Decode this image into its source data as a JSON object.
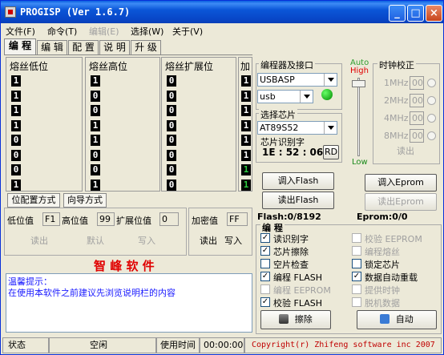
{
  "window": {
    "title": "PROGISP  (Ver 1.6.7)"
  },
  "title_buttons": {
    "minimize": "_",
    "maximize": "□",
    "close": "×"
  },
  "menu": [
    "文件(F)",
    "命令(T)",
    "编辑(E)",
    "选择(W)",
    "关于(V)"
  ],
  "tabs": [
    "编 程",
    "编 辑",
    "配 置",
    "说 明",
    "升 级"
  ],
  "fuse_columns": [
    {
      "title": "熔丝低位",
      "bits": [
        "1",
        "1",
        "1",
        "1",
        "0",
        "0",
        "0",
        "1"
      ]
    },
    {
      "title": "熔丝高位",
      "bits": [
        "1",
        "0",
        "0",
        "1",
        "1",
        "0",
        "0",
        "1"
      ]
    },
    {
      "title": "熔丝扩展位",
      "bits": [
        "0",
        "0",
        "0",
        "0",
        "0",
        "0",
        "0",
        "0"
      ]
    },
    {
      "title": "加",
      "bits": [
        "1",
        "1",
        "1",
        "1",
        "1",
        "1",
        "1",
        "1"
      ],
      "green": [
        false,
        false,
        false,
        false,
        false,
        false,
        true,
        true
      ]
    }
  ],
  "config_tabs": {
    "bitwise": "位配置方式",
    "wizard": "向导方式"
  },
  "fuse_values": {
    "low_label": "低位值",
    "low_value": "F1",
    "high_label": "高位值",
    "high_value": "99",
    "ext_label": "扩展位值",
    "ext_value": "0",
    "read": "读出",
    "default": "默认",
    "write": "写入"
  },
  "lock": {
    "label": "加密值",
    "value": "FF",
    "read": "读出",
    "write": "写入"
  },
  "brand": "智 峰 软 件",
  "tip": {
    "title": "温馨提示：",
    "text": "在使用本软件之前建议先浏览说明栏的内容"
  },
  "programmer": {
    "group_title": "编程器及接口",
    "device": "USBASP",
    "port": "usb",
    "chip_group": "选择芯片",
    "chip": "AT89S52",
    "id_label": "芯片识别字",
    "id_value": "1E : 52 : 06",
    "rd_button": "RD"
  },
  "speed": {
    "auto": "Auto",
    "high": "High",
    "low": "Low"
  },
  "clock": {
    "title": "时钟校正",
    "options": [
      {
        "label": "1MHz",
        "value": "00"
      },
      {
        "label": "2MHz",
        "value": "00"
      },
      {
        "label": "4MHz",
        "value": "00"
      },
      {
        "label": "8MHz",
        "value": "00"
      }
    ],
    "read": "读出"
  },
  "actions": {
    "load_flash": "调入Flash",
    "read_flash": "读出Flash",
    "load_eeprom": "调入Eprom",
    "read_eeprom": "读出Eprom"
  },
  "memory": {
    "flash": "Flash:0/8192",
    "eprom": "Eprom:0/0"
  },
  "program_group": {
    "title": "编 程",
    "left": [
      {
        "label": "读识别字",
        "checked": true,
        "enabled": true
      },
      {
        "label": "芯片擦除",
        "checked": true,
        "enabled": true
      },
      {
        "label": "空片检查",
        "checked": false,
        "enabled": true
      },
      {
        "label": "编程 FLASH",
        "checked": true,
        "enabled": true
      },
      {
        "label": "编程 EEPROM",
        "checked": false,
        "enabled": false
      },
      {
        "label": "校验 FLASH",
        "checked": true,
        "enabled": true
      }
    ],
    "right": [
      {
        "label": "校验 EEPROM",
        "checked": false,
        "enabled": false
      },
      {
        "label": "编程熔丝",
        "checked": false,
        "enabled": false
      },
      {
        "label": "锁定芯片",
        "checked": false,
        "enabled": true
      },
      {
        "label": "数据自动重载",
        "checked": true,
        "enabled": true
      },
      {
        "label": "提供时钟",
        "checked": false,
        "enabled": false
      },
      {
        "label": "脱机数据",
        "checked": false,
        "enabled": false
      }
    ],
    "erase_button": "擦除",
    "auto_button": "自动"
  },
  "statusbar": {
    "status_label": "状态",
    "status_value": "空闲",
    "time_label": "使用时间",
    "time_value": "00:00:00",
    "copyright": "Copyright(r) Zhifeng software inc 2007"
  },
  "colors": {
    "title_bar": "#0b56d8",
    "brand_red": "#e00000",
    "tip_blue": "#1a1aff",
    "high_red": "#e00000",
    "auto_green": "#2e9e2e",
    "status_green": "#0a8a0a"
  }
}
